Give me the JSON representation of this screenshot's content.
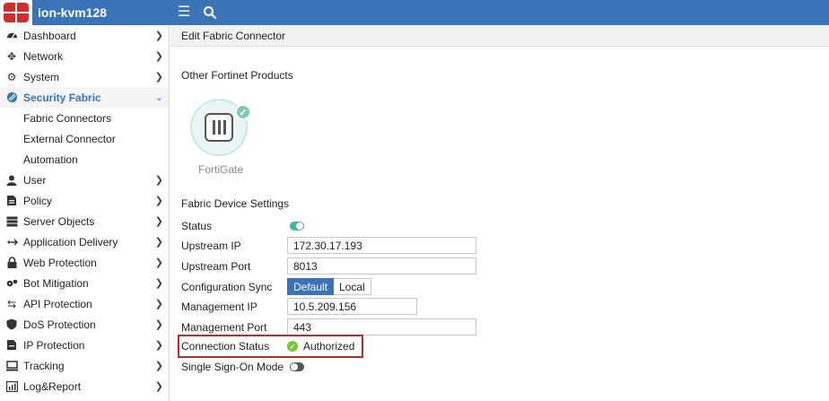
{
  "app": {
    "title": "ion-kvm128"
  },
  "topbar": {
    "menu_icon": "hamburger-icon",
    "search_icon": "search-icon"
  },
  "sidebar": {
    "items": [
      {
        "label": "Dashboard",
        "icon": "dashboard-icon"
      },
      {
        "label": "Network",
        "icon": "network-icon"
      },
      {
        "label": "System",
        "icon": "gear-icon"
      },
      {
        "label": "Security Fabric",
        "icon": "security-fabric-icon",
        "active": true
      },
      {
        "label": "Fabric Connectors",
        "sub": true
      },
      {
        "label": "External Connector",
        "sub": true
      },
      {
        "label": "Automation",
        "sub": true
      },
      {
        "label": "User",
        "icon": "user-icon"
      },
      {
        "label": "Policy",
        "icon": "policy-icon"
      },
      {
        "label": "Server Objects",
        "icon": "server-icon"
      },
      {
        "label": "Application Delivery",
        "icon": "application-delivery-icon"
      },
      {
        "label": "Web Protection",
        "icon": "lock-icon"
      },
      {
        "label": "Bot Mitigation",
        "icon": "bot-icon"
      },
      {
        "label": "API Protection",
        "icon": "api-icon"
      },
      {
        "label": "DoS Protection",
        "icon": "shield-icon"
      },
      {
        "label": "IP Protection",
        "icon": "ip-icon"
      },
      {
        "label": "Tracking",
        "icon": "tracking-icon"
      },
      {
        "label": "Log&Report",
        "icon": "log-icon"
      }
    ]
  },
  "main": {
    "header": "Edit Fabric Connector",
    "other_products_title": "Other Fortinet Products",
    "product": {
      "label": "FortiGate"
    },
    "settings_title": "Fabric Device Settings",
    "fields": {
      "status_label": "Status",
      "status_on": true,
      "upstream_ip_label": "Upstream IP",
      "upstream_ip_value": "172.30.17.193",
      "upstream_port_label": "Upstream Port",
      "upstream_port_value": "8013",
      "config_sync_label": "Configuration Sync",
      "config_sync_options": [
        "Default",
        "Local"
      ],
      "config_sync_selected": "Default",
      "mgmt_ip_label": "Management IP",
      "mgmt_ip_value": "10.5.209.156",
      "mgmt_port_label": "Management Port",
      "mgmt_port_value": "443",
      "connection_status_label": "Connection Status",
      "connection_status_value": "Authorized",
      "sso_label": "Single Sign-On Mode",
      "sso_on": false
    }
  },
  "colors": {
    "topbar": "#3b73b9",
    "accent": "#3b73b9",
    "toggle_on": "#3fb899",
    "authorized": "#7cc43a",
    "highlight_border": "#c62828"
  }
}
